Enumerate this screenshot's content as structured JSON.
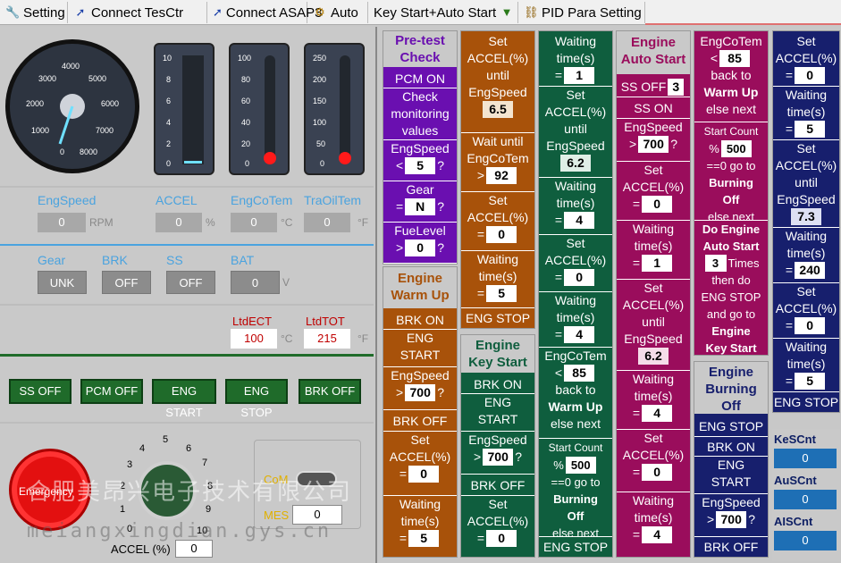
{
  "toolbar": {
    "setting": "Setting",
    "connect_tesctr": "Connect TesCtr",
    "connect_asap3": "Connect ASAP3",
    "auto": "Auto",
    "key_start_auto": "Key Start+Auto Start",
    "pid": "PID Para Setting"
  },
  "rpm_gauge": {
    "ticks": [
      "0",
      "1000",
      "2000",
      "3000",
      "4000",
      "5000",
      "6000",
      "7000",
      "8000"
    ]
  },
  "bar1": {
    "ticks": [
      "10",
      "8",
      "6",
      "4",
      "2",
      "0"
    ]
  },
  "bar2": {
    "ticks": [
      "100",
      "80",
      "60",
      "40",
      "20",
      "0"
    ]
  },
  "bar3": {
    "ticks": [
      "250",
      "200",
      "150",
      "100",
      "50",
      "0"
    ]
  },
  "row1": {
    "engspeed": "EngSpeed",
    "engspeed_val": "0",
    "rpm": "RPM",
    "accel": "ACCEL",
    "accel_val": "0",
    "pct": "%",
    "engcotem": "EngCoTem",
    "engcotem_val": "0",
    "degc": "°C",
    "traoiltem": "TraOilTem",
    "traoiltem_val": "0",
    "degf": "°F"
  },
  "row2": {
    "gear": "Gear",
    "gear_val": "UNK",
    "brk": "BRK",
    "brk_val": "OFF",
    "ss": "SS",
    "ss_val": "OFF",
    "bat": "BAT",
    "bat_val": "0",
    "v": "V"
  },
  "row3": {
    "ltdect": "LtdECT",
    "ltdect_val": "100",
    "degc": "°C",
    "ltdtot": "LtdTOT",
    "ltdtot_val": "215",
    "degf": "°F"
  },
  "buttons": {
    "ss_off": "SS OFF",
    "pcm_off": "PCM OFF",
    "eng_start": "ENG START",
    "eng_stop": "ENG STOP",
    "brk_off": "BRK OFF"
  },
  "bottom": {
    "emergency": "Emergency",
    "accel_label": "ACCEL (%)",
    "accel_val": "0",
    "com": "CoM",
    "mes": "MES",
    "mes_val": "0",
    "dial_ticks": [
      "0",
      "1",
      "2",
      "3",
      "4",
      "5",
      "6",
      "7",
      "8",
      "9",
      "10"
    ]
  },
  "pretest": {
    "title1": "Pre-test",
    "title2": "Check",
    "pcm_on": "PCM ON",
    "check1": "Check",
    "check2": "monitoring",
    "check3": "values",
    "engspeed": "EngSpeed",
    "engspeed_val": "5",
    "gear": "Gear",
    "gear_val": "N",
    "fuel": "FueLevel",
    "fuel_val": "0"
  },
  "warmup": {
    "title1": "Engine",
    "title2": "Warm Up",
    "brk_on": "BRK ON",
    "eng1": "ENG",
    "start": "START",
    "engspeed": "EngSpeed",
    "engspeed_val": "700",
    "brk_off": "BRK OFF",
    "set": "Set",
    "accel": "ACCEL(%)",
    "accel_val": "0",
    "waiting": "Waiting",
    "time": "time(s)",
    "time_val": "5"
  },
  "col2": {
    "set": "Set",
    "accel": "ACCEL(%)",
    "until": "until",
    "engspeed": "EngSpeed",
    "val1": "6.5",
    "wait_until": "Wait until",
    "engcotem": "EngCoTem",
    "val2": "92",
    "val3": "0",
    "waiting": "Waiting",
    "time": "time(s)",
    "val4": "5",
    "eng_stop": "ENG STOP"
  },
  "keystart": {
    "title1": "Engine",
    "title2": "Key Start",
    "brk_on": "BRK ON",
    "eng": "ENG",
    "start": "START",
    "engspeed": "EngSpeed",
    "engspeed_val": "700",
    "brk_off": "BRK OFF",
    "set": "Set",
    "accel": "ACCEL(%)",
    "accel_val": "0"
  },
  "col3": {
    "waiting": "Waiting",
    "time": "time(s)",
    "v1": "1",
    "set": "Set",
    "accel": "ACCEL(%)",
    "until": "until",
    "engspeed": "EngSpeed",
    "v2": "6.2",
    "v3": "4",
    "v4": "0",
    "v5": "4",
    "engcotem": "EngCoTem",
    "v6": "85",
    "back_to": "back to",
    "warm_up": "Warm Up",
    "else_next": "else next",
    "start_count": "Start Count",
    "v7": "500",
    "go_to": "==0 go to",
    "burning": "Burning",
    "off": "Off",
    "eng_stop": "ENG STOP"
  },
  "autostart": {
    "title1": "Engine",
    "title2": "Auto Start",
    "ss_off": "SS OFF",
    "ss_val": "3",
    "ss_on": "SS ON",
    "engspeed": "EngSpeed",
    "v1": "700",
    "set": "Set",
    "accel": "ACCEL(%)",
    "v2": "0",
    "waiting": "Waiting",
    "time": "time(s)",
    "v3": "1",
    "until": "until",
    "v4": "6.2",
    "v5": "4",
    "v6": "0",
    "v7": "4"
  },
  "col5": {
    "engcotem": "EngCoTem",
    "v1": "85",
    "back_to": "back to",
    "warm_up": "Warm Up",
    "else_next": "else next",
    "start_count": "Start Count",
    "v2": "500",
    "go_to": "==0 go to",
    "burning": "Burning",
    "off": "Off",
    "do_engine": "Do Engine",
    "auto_start": "Auto Start",
    "v3": "3",
    "times": "Times",
    "then_do": "then do",
    "eng_stop": "ENG STOP",
    "and_go": "and go to",
    "engine": "Engine",
    "key_start": "Key Start"
  },
  "burning": {
    "title1": "Engine",
    "title2": "Burning",
    "title3": "Off",
    "eng_stop": "ENG STOP",
    "brk_on": "BRK ON",
    "eng": "ENG",
    "start": "START",
    "engspeed": "EngSpeed",
    "v1": "700",
    "brk_off": "BRK OFF"
  },
  "col6": {
    "set": "Set",
    "accel": "ACCEL(%)",
    "v1": "0",
    "waiting": "Waiting",
    "time": "time(s)",
    "v2": "5",
    "until": "until",
    "engspeed": "EngSpeed",
    "v3": "7.3",
    "v4": "240",
    "v5": "0",
    "v6": "5",
    "eng_stop": "ENG STOP"
  },
  "counters": {
    "kescnt": "KeSCnt",
    "kescnt_val": "0",
    "auscnt": "AuSCnt",
    "auscnt_val": "0",
    "aiscnt": "AISCnt",
    "aiscnt_val": "0"
  },
  "watermark": {
    "cn": "合肥美昂兴电子技术有限公司",
    "en": "meiangxingdian.gys.cn"
  },
  "colors": {
    "purple": "#6a0fb0",
    "brown": "#a8520a",
    "green": "#0f5e3e",
    "magenta": "#9a0d5c",
    "navy": "#171f6d"
  }
}
